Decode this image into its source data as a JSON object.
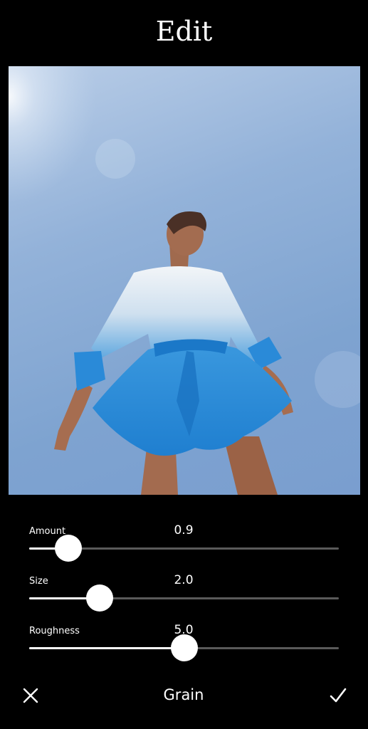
{
  "header": {
    "title": "Edit"
  },
  "photo": {
    "description_icon": "photo-preview"
  },
  "sliders": [
    {
      "label": "Amount",
      "value": "0.9",
      "fraction": 0.126
    },
    {
      "label": "Size",
      "value": "2.0",
      "fraction": 0.227
    },
    {
      "label": "Roughness",
      "value": "5.0",
      "fraction": 0.5
    }
  ],
  "bottom_bar": {
    "tool_name": "Grain",
    "cancel_icon": "close-icon",
    "confirm_icon": "check-icon"
  },
  "colors": {
    "background": "#000000",
    "track": "#5a5a5a",
    "track_fill": "#ffffff",
    "thumb": "#ffffff"
  }
}
